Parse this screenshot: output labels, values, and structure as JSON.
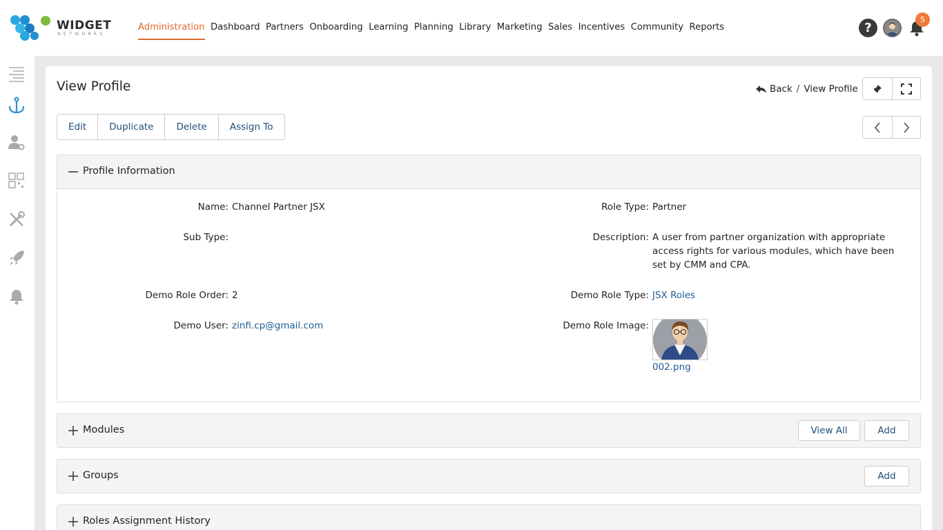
{
  "brand": {
    "name": "WIDGET",
    "tagline": "NETWORKS",
    "accent": "#e06a2f"
  },
  "nav": {
    "items": [
      {
        "label": "Administration",
        "active": true
      },
      {
        "label": "Dashboard"
      },
      {
        "label": "Partners"
      },
      {
        "label": "Onboarding"
      },
      {
        "label": "Learning"
      },
      {
        "label": "Planning"
      },
      {
        "label": "Library"
      },
      {
        "label": "Marketing"
      },
      {
        "label": "Sales"
      },
      {
        "label": "Incentives"
      },
      {
        "label": "Community"
      },
      {
        "label": "Reports"
      }
    ]
  },
  "header": {
    "help": "?",
    "notifications_count": "5"
  },
  "rail": {
    "icons": [
      "menu-icon",
      "anchor-icon",
      "user-settings-icon",
      "qr-grid-icon",
      "tools-icon",
      "rocket-icon",
      "bell-icon"
    ]
  },
  "page": {
    "title": "View Profile",
    "breadcrumb": {
      "back": "Back",
      "separator": "/",
      "current": "View Profile"
    }
  },
  "actions": {
    "edit": "Edit",
    "duplicate": "Duplicate",
    "delete": "Delete",
    "assign": "Assign To"
  },
  "profile": {
    "section_title": "Profile Information",
    "name_label": "Name:",
    "name_value": "Channel Partner JSX",
    "role_type_label": "Role Type:",
    "role_type_value": "Partner",
    "sub_type_label": "Sub Type:",
    "sub_type_value": "",
    "description_label": "Description:",
    "description_value": "A user from partner organization with appropriate access rights for various modules, which have been set by CMM and CPA.",
    "demo_role_order_label": "Demo Role Order:",
    "demo_role_order_value": "2",
    "demo_role_type_label": "Demo Role Type:",
    "demo_role_type_value": "JSX Roles",
    "demo_user_label": "Demo User:",
    "demo_user_value": "zinfi.cp@gmail.com",
    "demo_role_image_label": "Demo Role Image:",
    "demo_role_image_file": "002.png"
  },
  "modules": {
    "title": "Modules",
    "view_all": "View All",
    "add": "Add"
  },
  "groups": {
    "title": "Groups",
    "add": "Add"
  },
  "history": {
    "title": "Roles Assignment History"
  }
}
